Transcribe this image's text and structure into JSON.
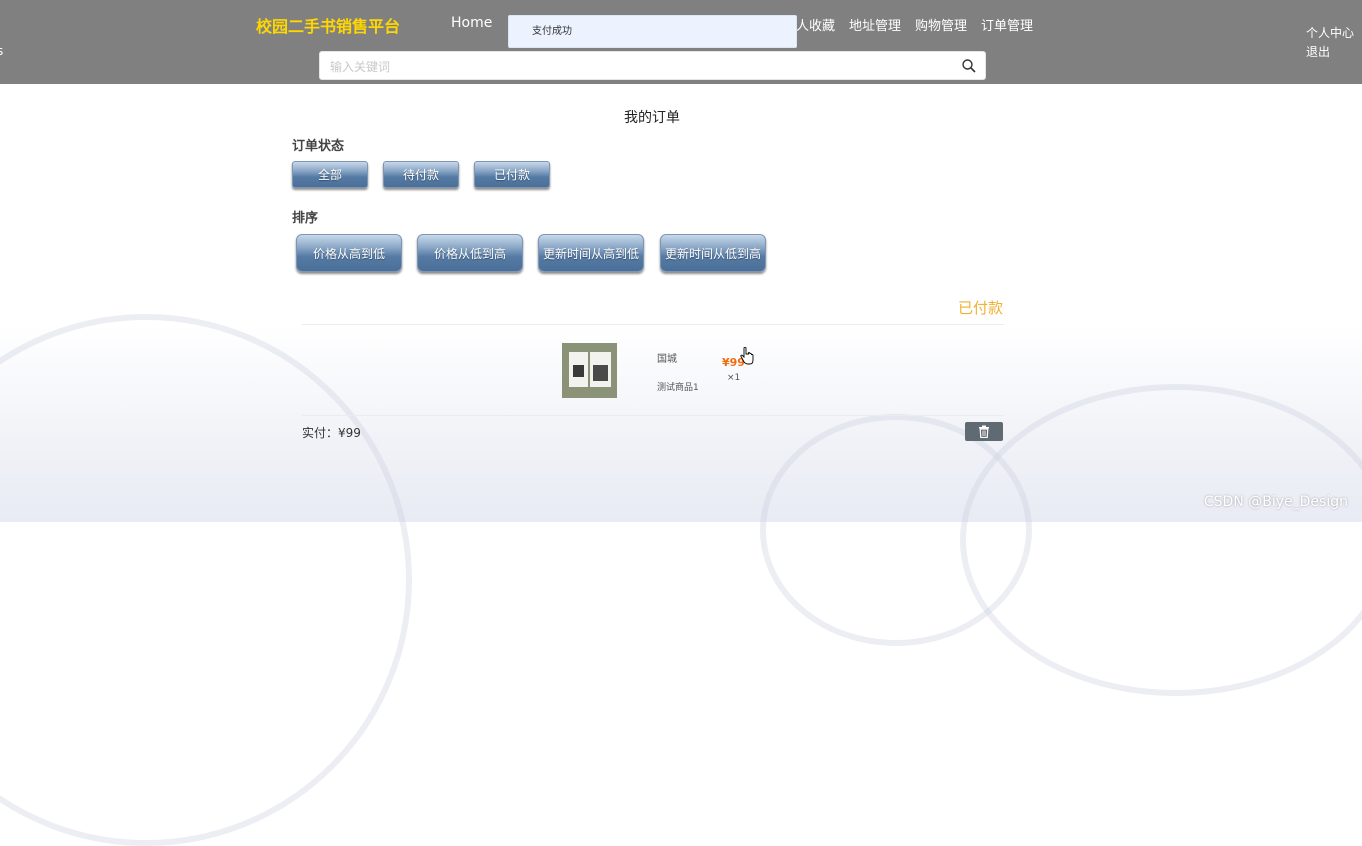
{
  "header": {
    "brand": "校园二手书销售平台",
    "home": "Home",
    "nav": [
      "个人收藏",
      "地址管理",
      "购物管理",
      "订单管理"
    ],
    "user_links": [
      "个人中心",
      "退出"
    ],
    "left_stub": "s",
    "search": {
      "placeholder": "输入关键词",
      "value": ""
    },
    "toast": "支付成功"
  },
  "main": {
    "title": "我的订单",
    "status_label": "订单状态",
    "status_buttons": [
      "全部",
      "待付款",
      "已付款"
    ],
    "sort_label": "排序",
    "sort_buttons": [
      "价格从高到低",
      "价格从低到高",
      "更新时间从高到低",
      "更新时间从低到高"
    ]
  },
  "order": {
    "status": "已付款",
    "shop": "国城",
    "goods_name": "测试商品1",
    "price": "¥99",
    "qty": "×1",
    "paid_label": "实付：",
    "paid_value": "¥99"
  },
  "watermark": "CSDN @Biye_Design",
  "colors": {
    "header_bg": "#808080",
    "brand": "#ffd700",
    "status": "#f0b030",
    "price": "#f46b0d"
  },
  "icons": [
    "search-icon",
    "trash-icon",
    "hand-cursor-icon"
  ]
}
